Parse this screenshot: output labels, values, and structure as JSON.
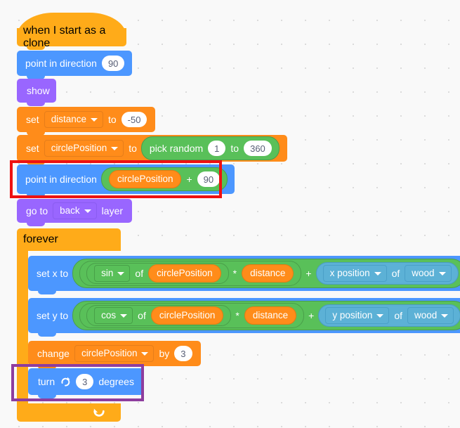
{
  "workspace": {
    "background": "#F9F9F9",
    "grid_dot_color": "#D9D9D9"
  },
  "palette": {
    "events": "#FFAB19",
    "motion": "#4C97FF",
    "looks": "#9966FF",
    "variables": "#FF8C1A",
    "control": "#FFAB19",
    "operators": "#59C059",
    "sensing": "#5CB1D6"
  },
  "script": {
    "hat": {
      "label": "when I start as a clone"
    },
    "blocks": [
      {
        "id": "point-in-direction-90",
        "label": "point in direction",
        "value": "90"
      },
      {
        "id": "show",
        "label": "show"
      },
      {
        "id": "set-distance",
        "label_set": "set",
        "variable": "distance",
        "label_to": "to",
        "value": "-50"
      },
      {
        "id": "set-circleposition",
        "label_set": "set",
        "variable": "circlePosition",
        "label_to": "to",
        "pick_random_label": "pick random",
        "pick_from": "1",
        "pick_to_label": "to",
        "pick_to": "360"
      },
      {
        "id": "point-in-direction-expr",
        "label": "point in direction",
        "operand_left": "circlePosition",
        "operator": "+",
        "operand_right": "90"
      },
      {
        "id": "go-to-layer",
        "label_prefix": "go to",
        "layer": "back",
        "label_suffix": "layer"
      },
      {
        "id": "forever",
        "label": "forever"
      },
      {
        "id": "set-x-to",
        "label": "set x to",
        "trig_function": "sin",
        "of_label": "of",
        "trig_operand": "circlePosition",
        "mult_symbol": "*",
        "mult_operand": "distance",
        "plus_symbol": "+",
        "sensing_property": "x position",
        "sensing_of_label": "of",
        "sensing_target": "wood"
      },
      {
        "id": "set-y-to",
        "label": "set y to",
        "trig_function": "cos",
        "of_label": "of",
        "trig_operand": "circlePosition",
        "mult_symbol": "*",
        "mult_operand": "distance",
        "plus_symbol": "+",
        "sensing_property": "y position",
        "sensing_of_label": "of",
        "sensing_target": "wood"
      },
      {
        "id": "change-circleposition",
        "label_change": "change",
        "variable": "circlePosition",
        "label_by": "by",
        "value": "3"
      },
      {
        "id": "turn-degrees",
        "label_turn": "turn",
        "direction_icon": "turn-clockwise-icon",
        "value": "3",
        "label_degrees": "degrees"
      }
    ]
  },
  "highlights": [
    {
      "id": "red-highlight",
      "color": "#EE1111",
      "target": "point-in-direction-expr"
    },
    {
      "id": "purple-highlight",
      "color": "#8E3D9E",
      "target": "turn-degrees"
    }
  ]
}
